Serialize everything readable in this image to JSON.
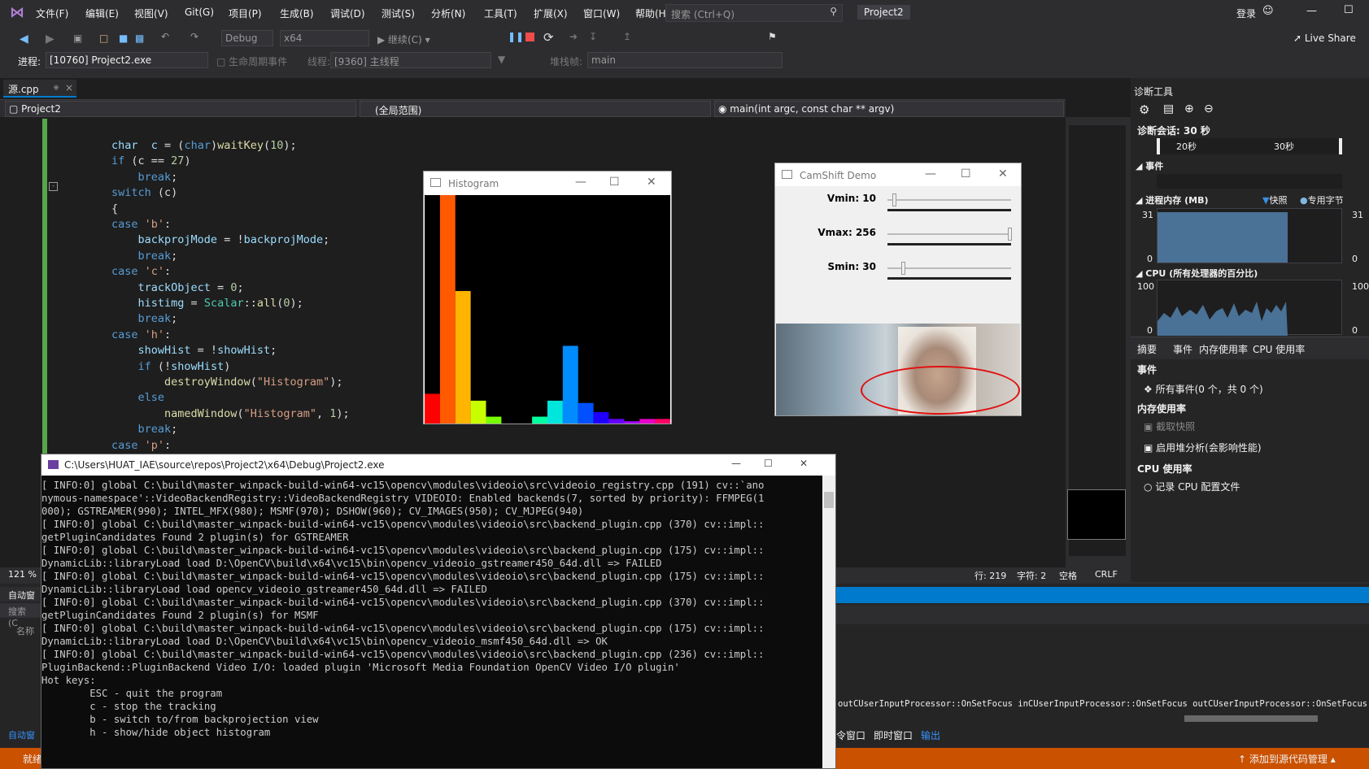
{
  "menubar": {
    "items": [
      "文件(F)",
      "编辑(E)",
      "视图(V)",
      "Git(G)",
      "项目(P)",
      "生成(B)",
      "调试(D)",
      "测试(S)",
      "分析(N)",
      "工具(T)",
      "扩展(X)",
      "窗口(W)",
      "帮助(H)"
    ],
    "search_placeholder": "搜索 (Ctrl+Q)",
    "project": "Project2",
    "login": "登录"
  },
  "toolbar": {
    "config": "Debug",
    "platform": "x64",
    "continue": "继续(C)",
    "live_share": "Live Share"
  },
  "debugbar": {
    "process_label": "进程:",
    "process": "[10760] Project2.exe",
    "lifecycle": "生命周期事件",
    "thread_label": "线程:",
    "thread": "[9360] 主线程",
    "stack_label": "堆栈帧:",
    "stack": "main"
  },
  "tabs": {
    "file": "源.cpp",
    "project": "Project2",
    "scope": "(全局范围)",
    "function": "main(int argc, const char ** argv)"
  },
  "code": [
    [
      "        ",
      [
        [
          "vr",
          "char"
        ],
        [
          "",
          "  "
        ],
        [
          "vr",
          "c"
        ],
        [
          "",
          " = ("
        ],
        [
          "kw",
          "char"
        ],
        [
          "",
          ")"
        ],
        [
          "fn",
          "waitKey"
        ],
        [
          "",
          "("
        ],
        [
          "nm",
          "10"
        ],
        [
          "",
          ");"
        ]
      ]
    ],
    [
      "        ",
      [
        [
          "kw",
          "if"
        ],
        [
          "",
          " (c == "
        ],
        [
          "nm",
          "27"
        ],
        [
          "",
          ")"
        ]
      ]
    ],
    [
      "            ",
      [
        [
          "kw",
          "break"
        ],
        [
          "",
          ";"
        ]
      ]
    ],
    [
      "        ",
      [
        [
          "kw",
          "switch"
        ],
        [
          "",
          " (c)"
        ]
      ]
    ],
    [
      "        ",
      [
        [
          "",
          "{"
        ]
      ]
    ],
    [
      "        ",
      [
        [
          "kw",
          "case"
        ],
        [
          "",
          " "
        ],
        [
          "st",
          "'b'"
        ],
        [
          "",
          ":"
        ]
      ]
    ],
    [
      "            ",
      [
        [
          "vr",
          "backprojMode"
        ],
        [
          "",
          " = !"
        ],
        [
          "vr",
          "backprojMode"
        ],
        [
          "",
          ";"
        ]
      ]
    ],
    [
      "            ",
      [
        [
          "kw",
          "break"
        ],
        [
          "",
          ";"
        ]
      ]
    ],
    [
      "        ",
      [
        [
          "kw",
          "case"
        ],
        [
          "",
          " "
        ],
        [
          "st",
          "'c'"
        ],
        [
          "",
          ":"
        ]
      ]
    ],
    [
      "            ",
      [
        [
          "vr",
          "trackObject"
        ],
        [
          "",
          " = "
        ],
        [
          "nm",
          "0"
        ],
        [
          "",
          ";"
        ]
      ]
    ],
    [
      "            ",
      [
        [
          "vr",
          "histimg"
        ],
        [
          "",
          " = "
        ],
        [
          "ty",
          "Scalar"
        ],
        [
          "",
          "::"
        ],
        [
          "fn",
          "all"
        ],
        [
          "",
          "("
        ],
        [
          "nm",
          "0"
        ],
        [
          "",
          ");"
        ]
      ]
    ],
    [
      "            ",
      [
        [
          "kw",
          "break"
        ],
        [
          "",
          ";"
        ]
      ]
    ],
    [
      "        ",
      [
        [
          "kw",
          "case"
        ],
        [
          "",
          " "
        ],
        [
          "st",
          "'h'"
        ],
        [
          "",
          ":"
        ]
      ]
    ],
    [
      "            ",
      [
        [
          "vr",
          "showHist"
        ],
        [
          "",
          " = !"
        ],
        [
          "vr",
          "showHist"
        ],
        [
          "",
          ";"
        ]
      ]
    ],
    [
      "            ",
      [
        [
          "kw",
          "if"
        ],
        [
          "",
          " (!"
        ],
        [
          "vr",
          "showHist"
        ],
        [
          "",
          ")"
        ]
      ]
    ],
    [
      "                ",
      [
        [
          "fn",
          "destroyWindow"
        ],
        [
          "",
          "("
        ],
        [
          "st",
          "\"Histogram\""
        ],
        [
          "",
          ");"
        ]
      ]
    ],
    [
      "            ",
      [
        [
          "kw",
          "else"
        ]
      ]
    ],
    [
      "                ",
      [
        [
          "fn",
          "namedWindow"
        ],
        [
          "",
          "("
        ],
        [
          "st",
          "\"Histogram\""
        ],
        [
          "",
          ", "
        ],
        [
          "nm",
          "1"
        ],
        [
          "",
          ");"
        ]
      ]
    ],
    [
      "            ",
      [
        [
          "kw",
          "break"
        ],
        [
          "",
          ";"
        ]
      ]
    ],
    [
      "        ",
      [
        [
          "kw",
          "case"
        ],
        [
          "",
          " "
        ],
        [
          "st",
          "'p'"
        ],
        [
          "",
          ":"
        ]
      ]
    ]
  ],
  "histogram": {
    "title": "Histogram",
    "bars": [
      {
        "v": 0.13,
        "c": "#ff0000"
      },
      {
        "v": 1.0,
        "c": "#ff5a00"
      },
      {
        "v": 0.58,
        "c": "#ffb400"
      },
      {
        "v": 0.1,
        "c": "#c8ff00"
      },
      {
        "v": 0.03,
        "c": "#78ff00"
      },
      {
        "v": 0.0,
        "c": "#00ff00"
      },
      {
        "v": 0.0,
        "c": "#00ff5a"
      },
      {
        "v": 0.03,
        "c": "#00ffa0"
      },
      {
        "v": 0.1,
        "c": "#00e6dc"
      },
      {
        "v": 0.34,
        "c": "#008cff"
      },
      {
        "v": 0.09,
        "c": "#0050ff"
      },
      {
        "v": 0.05,
        "c": "#1e00ff"
      },
      {
        "v": 0.02,
        "c": "#6400ff"
      },
      {
        "v": 0.01,
        "c": "#a000ff"
      },
      {
        "v": 0.02,
        "c": "#e600c8"
      },
      {
        "v": 0.02,
        "c": "#ff0064"
      }
    ]
  },
  "camshift": {
    "title": "CamShift Demo",
    "sliders": [
      {
        "label": "Vmin: 10",
        "value": 10,
        "max": 256
      },
      {
        "label": "Vmax: 256",
        "value": 256,
        "max": 256
      },
      {
        "label": "Smin: 30",
        "value": 30,
        "max": 256
      }
    ]
  },
  "diagnostics": {
    "title": "诊断工具",
    "session": "诊断会话: 30 秒",
    "t20": "20秒",
    "t30": "30秒",
    "events": "事件",
    "memory": "进程内存 (MB)",
    "snapshot": "快照",
    "private": "专用字节",
    "mem_max": "31",
    "mem_min": "0",
    "cpu": "CPU (所有处理器的百分比)",
    "cpu_max": "100",
    "cpu_min": "0",
    "tabs": [
      "摘要",
      "事件",
      "内存使用率",
      "CPU 使用率"
    ],
    "sec_events": "事件",
    "all_events": "所有事件(0 个，共 0 个)",
    "sec_mem": "内存使用率",
    "take_snapshot": "截取快照",
    "heap": "启用堆分析(会影响性能)",
    "sec_cpu": "CPU 使用率",
    "record_cpu": "记录 CPU 配置文件"
  },
  "editor_status": {
    "zoom": "121 %",
    "line": "行: 219",
    "col": "字符: 2",
    "space": "空格",
    "crlf": "CRLF"
  },
  "console": {
    "title": "C:\\Users\\HUAT_IAE\\source\\repos\\Project2\\x64\\Debug\\Project2.exe",
    "lines": [
      "[ INFO:0] global C:\\build\\master_winpack-build-win64-vc15\\opencv\\modules\\videoio\\src\\videoio_registry.cpp (191) cv::`ano",
      "nymous-namespace'::VideoBackendRegistry::VideoBackendRegistry VIDEOIO: Enabled backends(7, sorted by priority): FFMPEG(1",
      "000); GSTREAMER(990); INTEL_MFX(980); MSMF(970); DSHOW(960); CV_IMAGES(950); CV_MJPEG(940)",
      "[ INFO:0] global C:\\build\\master_winpack-build-win64-vc15\\opencv\\modules\\videoio\\src\\backend_plugin.cpp (370) cv::impl::",
      "getPluginCandidates Found 2 plugin(s) for GSTREAMER",
      "[ INFO:0] global C:\\build\\master_winpack-build-win64-vc15\\opencv\\modules\\videoio\\src\\backend_plugin.cpp (175) cv::impl::",
      "DynamicLib::libraryLoad load D:\\OpenCV\\build\\x64\\vc15\\bin\\opencv_videoio_gstreamer450_64d.dll => FAILED",
      "[ INFO:0] global C:\\build\\master_winpack-build-win64-vc15\\opencv\\modules\\videoio\\src\\backend_plugin.cpp (175) cv::impl::",
      "DynamicLib::libraryLoad load opencv_videoio_gstreamer450_64d.dll => FAILED",
      "[ INFO:0] global C:\\build\\master_winpack-build-win64-vc15\\opencv\\modules\\videoio\\src\\backend_plugin.cpp (370) cv::impl::",
      "getPluginCandidates Found 2 plugin(s) for MSMF",
      "[ INFO:0] global C:\\build\\master_winpack-build-win64-vc15\\opencv\\modules\\videoio\\src\\backend_plugin.cpp (175) cv::impl::",
      "DynamicLib::libraryLoad load D:\\OpenCV\\build\\x64\\vc15\\bin\\opencv_videoio_msmf450_64d.dll => OK",
      "[ INFO:0] global C:\\build\\master_winpack-build-win64-vc15\\opencv\\modules\\videoio\\src\\backend_plugin.cpp (236) cv::impl::",
      "PluginBackend::PluginBackend Video I/O: loaded plugin 'Microsoft Media Foundation OpenCV Video I/O plugin'",
      "",
      "",
      "Hot keys:",
      "        ESC - quit the program",
      "        c - stop the tracking",
      "        b - switch to/from backprojection view",
      "        h - show/hide object histogram"
    ]
  },
  "output": {
    "text": "outCUserInputProcessor::OnSetFocus inCUserInputProcessor::OnSetFocus outCUserInputProcessor::OnSetFocus out",
    "tabs": [
      "令窗口",
      "即时窗口",
      "输出"
    ]
  },
  "leftpanel": {
    "auto": "自动窗",
    "search": "搜索(C",
    "name": "名称",
    "auto2": "自动窗"
  },
  "statusbar": {
    "ready": "就绪",
    "source": "添加到源代码管理"
  }
}
